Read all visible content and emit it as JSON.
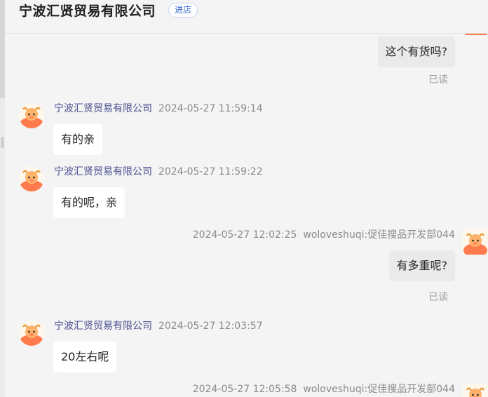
{
  "header": {
    "shop_name": "宁波汇贤贸易有限公司",
    "enter_shop": "进店"
  },
  "messages": [
    {
      "side": "out",
      "text": "这个有货吗?",
      "status": "已读"
    },
    {
      "side": "in",
      "sender": "宁波汇贤贸易有限公司",
      "time": "2024-05-27 11:59:14",
      "text": "有的亲"
    },
    {
      "side": "in",
      "sender": "宁波汇贤贸易有限公司",
      "time": "2024-05-27 11:59:22",
      "text": "有的呢，亲"
    },
    {
      "side": "out",
      "sender": "woloveshuqi:促佳搜品开发部044",
      "time": "2024-05-27 12:02:25",
      "text": "有多重呢?",
      "status": "已读"
    },
    {
      "side": "in",
      "sender": "宁波汇贤贸易有限公司",
      "time": "2024-05-27 12:03:57",
      "text": "20左右呢"
    },
    {
      "side": "out",
      "sender": "woloveshuqi:促佳搜品开发部044",
      "time": "2024-05-27 12:05:58"
    }
  ],
  "colors": {
    "avatar_orange": "#ff7a4d",
    "sender_blue": "#4a4f8f",
    "link_blue": "#3366cc"
  },
  "icons": {
    "seller_avatar": "orange-mascot-icon",
    "buyer_avatar": "orange-mascot-icon"
  }
}
